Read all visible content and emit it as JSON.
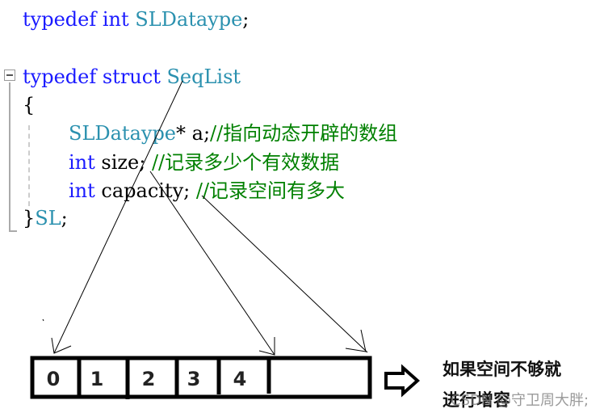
{
  "code": {
    "line1": {
      "kw1": "typedef",
      "kw2": "int",
      "type": "SLDataype",
      "end": ";"
    },
    "line2": {
      "kw1": "typedef",
      "kw2": "struct",
      "type": "SeqList"
    },
    "open_brace": "{",
    "field_a": {
      "type": "SLDataype",
      "rest": "* a;",
      "comment": "//指向动态开辟的数组"
    },
    "field_size": {
      "kw": "int",
      "rest": " size; ",
      "comment": "//记录多少个有效数据"
    },
    "field_capacity": {
      "kw": "int",
      "rest": " capacity; ",
      "comment": "//记录空间有多大"
    },
    "close_brace": "}",
    "alias": "SL",
    "alias_end": ";"
  },
  "array": {
    "cells": [
      "0",
      "1",
      "2",
      "3",
      "4",
      ""
    ]
  },
  "note": {
    "line1": "如果空间不够就",
    "line2": "进行增容"
  },
  "watermark": "CSDN @守卫周大胖;",
  "colors": {
    "keyword": "#1a1aff",
    "type": "#2b91af",
    "comment": "#008000"
  }
}
